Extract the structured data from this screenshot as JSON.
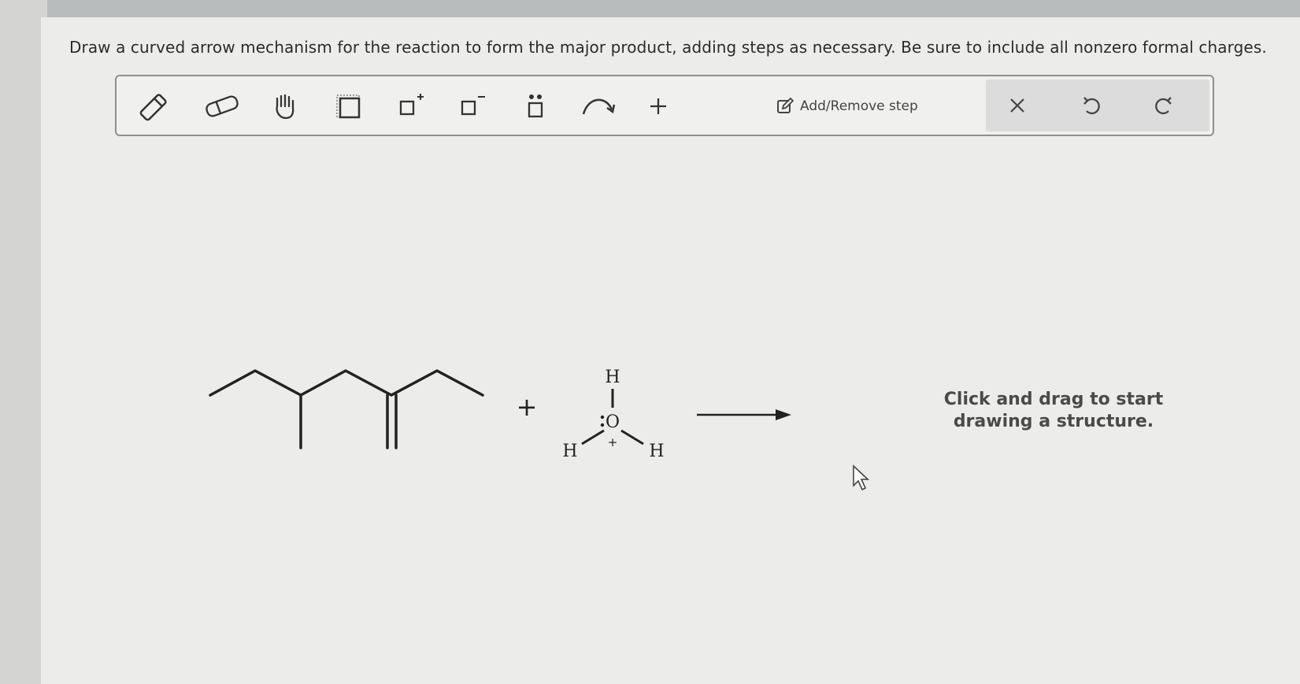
{
  "question": {
    "text": "Draw a curved arrow mechanism for the reaction to form the major product, adding steps as necessary. Be sure to include all nonzero formal charges."
  },
  "toolbar": {
    "tools": [
      {
        "name": "pencil-icon"
      },
      {
        "name": "eraser-icon"
      },
      {
        "name": "hand-icon"
      },
      {
        "name": "selection-icon"
      },
      {
        "name": "positive-charge-icon"
      },
      {
        "name": "negative-charge-icon"
      },
      {
        "name": "lone-pair-icon"
      },
      {
        "name": "curved-arrow-icon"
      },
      {
        "name": "plus-icon"
      }
    ],
    "add_remove_step_label": "Add/Remove step",
    "clear_icon": "close-icon",
    "undo_icon": "undo-icon",
    "redo_icon": "redo-icon"
  },
  "reaction": {
    "plus_sign": "+",
    "hydronium": {
      "top_atom": "H",
      "center_atom": "O",
      "left_atom": "H",
      "right_atom": "H",
      "charge": "+"
    }
  },
  "canvas": {
    "hint": "Click and drag to start\ndrawing a structure."
  }
}
